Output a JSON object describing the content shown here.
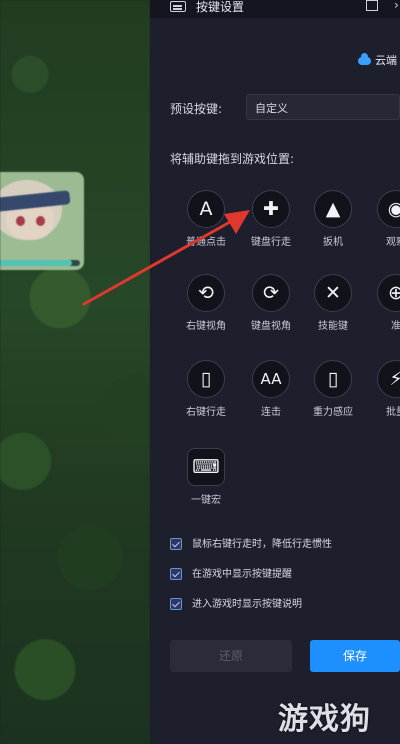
{
  "window": {
    "title": "按键设置"
  },
  "cloud_label": "云端",
  "preset": {
    "label": "预设按键:",
    "value": "自定义"
  },
  "drag_hint": "将辅助键拖到游戏位置:",
  "keys": [
    {
      "glyph": "A",
      "label": "普通点击",
      "icon": "tap-icon"
    },
    {
      "glyph": "✚",
      "label": "键盘行走",
      "icon": "dpad-icon"
    },
    {
      "glyph": "▲",
      "label": "扳机",
      "icon": "bullet-icon"
    },
    {
      "glyph": "◉",
      "label": "观察",
      "icon": "eye-icon"
    },
    {
      "glyph": "⟲",
      "label": "右键视角",
      "icon": "mouse-rotate-icon"
    },
    {
      "glyph": "⟳",
      "label": "键盘视角",
      "icon": "keyboard-rotate-icon"
    },
    {
      "glyph": "✕",
      "label": "技能键",
      "icon": "crossed-swords-icon"
    },
    {
      "glyph": "⊕",
      "label": "准",
      "icon": "crosshair-icon"
    },
    {
      "glyph": "▯",
      "label": "右键行走",
      "icon": "mouse-icon"
    },
    {
      "glyph": "AA",
      "label": "连击",
      "icon": "combo-icon"
    },
    {
      "glyph": "▯",
      "label": "重力感应",
      "icon": "phone-tilt-icon"
    },
    {
      "glyph": "⚡",
      "label": "批量",
      "icon": "lightning-icon"
    },
    {
      "glyph": "⌨",
      "label": "一键宏",
      "icon": "macro-icon"
    }
  ],
  "options": [
    {
      "label": "鼠标右键行走时，降低行走惯性",
      "checked": true
    },
    {
      "label": "在游戏中显示按键提醒",
      "checked": true
    },
    {
      "label": "进入游戏时显示按键说明",
      "checked": true
    }
  ],
  "buttons": {
    "restore": "还原",
    "save": "保存"
  },
  "watermark": "游戏狗",
  "colors": {
    "accent": "#1d8fff",
    "arrow": "#e0382f",
    "panel_bg": "#1d1f2c"
  }
}
